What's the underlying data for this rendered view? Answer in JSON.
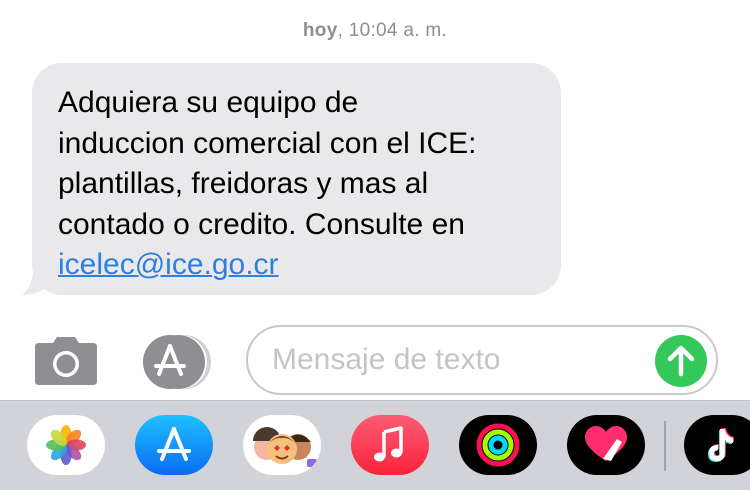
{
  "conversation": {
    "timestamp_day": "hoy",
    "timestamp_time": ", 10:04 a. m."
  },
  "message": {
    "lines": [
      "Adquiera su equipo de",
      "induccion comercial con el ICE:",
      "plantillas, freidoras y mas al",
      "contado o credito. Consulte en"
    ],
    "link": "icelec@ice.go.cr"
  },
  "composer": {
    "placeholder": "Mensaje de texto",
    "camera_icon": "camera-icon",
    "appstore_icon": "app-store-icon",
    "send_icon": "arrow-up-icon",
    "send_color": "#34c759"
  },
  "app_drawer": {
    "apps": [
      {
        "icon": "photos-icon"
      },
      {
        "icon": "app-store-icon"
      },
      {
        "icon": "memoji-stickers-icon"
      },
      {
        "icon": "music-icon"
      },
      {
        "icon": "activity-icon"
      },
      {
        "icon": "digital-touch-icon"
      },
      {
        "icon": "tiktok-icon"
      }
    ]
  },
  "colors": {
    "bubble": "#e9e9eb",
    "link": "#2f7fe0",
    "dock": "#d1d3d9"
  }
}
